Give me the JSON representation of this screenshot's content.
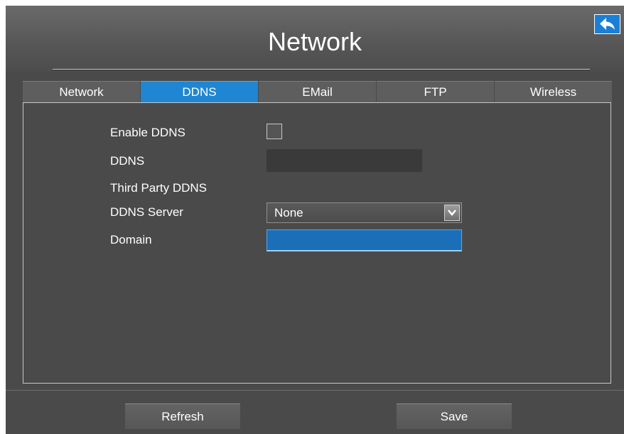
{
  "window": {
    "title": "Network"
  },
  "tabs": [
    {
      "label": "Network",
      "active": false
    },
    {
      "label": "DDNS",
      "active": true
    },
    {
      "label": "EMail",
      "active": false
    },
    {
      "label": "FTP",
      "active": false
    },
    {
      "label": "Wireless",
      "active": false
    }
  ],
  "form": {
    "enable_ddns_label": "Enable DDNS",
    "enable_ddns_checked": false,
    "ddns_label": "DDNS",
    "ddns_value": "",
    "third_party_label": "Third Party DDNS",
    "server_label": "DDNS Server",
    "server_value": "None",
    "domain_label": "Domain",
    "domain_value": ""
  },
  "buttons": {
    "refresh_label": "Refresh",
    "save_label": "Save"
  },
  "icons": {
    "back": "back-arrow-icon",
    "dropdown": "chevron-down-icon"
  },
  "colors": {
    "accent": "#1f86d3",
    "background": "#4a4a4a"
  }
}
